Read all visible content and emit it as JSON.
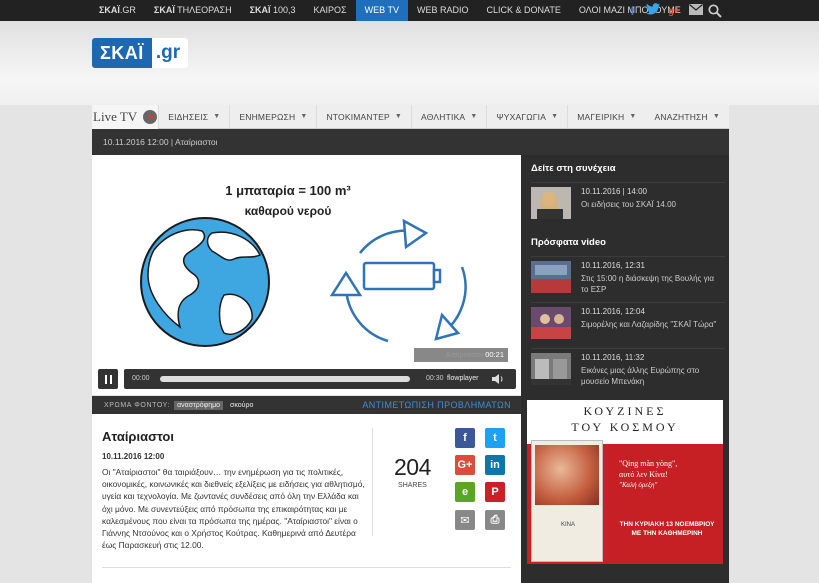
{
  "topnav": {
    "items": [
      {
        "bold": "ΣΚΑΪ",
        "rest": ".GR",
        "active": false
      },
      {
        "bold": "ΣΚΑΪ",
        "rest": " ΤΗΛΕΟΡΑΣΗ",
        "active": false
      },
      {
        "bold": "ΣΚΑΪ",
        "rest": " 100,3",
        "active": false
      },
      {
        "bold": "",
        "rest": "ΚΑΙΡΟΣ",
        "active": false
      },
      {
        "bold": "",
        "rest": "WEB TV",
        "active": true
      },
      {
        "bold": "",
        "rest": "WEB RADIO",
        "active": false
      },
      {
        "bold": "",
        "rest": "CLICK & DONATE",
        "active": false
      },
      {
        "bold": "",
        "rest": "ΟΛΟΙ ΜΑΖΙ ΜΠΟΡΟΥΜΕ",
        "active": false
      }
    ],
    "social_icons": [
      "facebook-icon",
      "twitter-icon",
      "googleplus-icon",
      "mail-icon"
    ]
  },
  "logo": {
    "main": "ΣΚΑΪ",
    "domain": ".gr"
  },
  "mainnav": {
    "live_tv": "Live TV",
    "items": [
      "ΕΙΔΗΣΕΙΣ",
      "ΕΝΗΜΕΡΩΣΗ",
      "ΝΤΟΚΙΜΑΝΤΕΡ",
      "ΑΘΛΗΤΙΚΑ",
      "ΨΥΧΑΓΩΓΙΑ",
      "ΜΑΓΕΙΡΙΚΗ"
    ],
    "search": "ΑΝΑΖΗΤΗΣΗ"
  },
  "breadcrumb": "10.11.2016 12:00 | Αταίριαστοι",
  "video": {
    "frame_text_line1": "1 μπαταρία = 100 m³",
    "frame_text_line2": "καθαρού νερού",
    "caption": "Αταίριαστοι",
    "caption_time": "00:21",
    "time_current": "00:00",
    "time_total": "00:30",
    "player_brand": "flowplayer"
  },
  "fontbar": {
    "label": "ΧΡΩΜΑ ΦΟΝΤΟΥ:",
    "options": [
      "αναστρόφημο",
      "σκούρο"
    ],
    "trouble": "ΑΝΤΙΜΕΤΩΠΙΣΗ ΠΡΟΒΛΗΜΑΤΩΝ"
  },
  "article": {
    "title": "Αταίριαστοι",
    "date": "10.11.2016 12:00",
    "body": "Οι \"Αταίριαστοι\" θα ταιριάξουν… την ενημέρωση για τις πολιτικές, οικονομικές, κοινωνικές και διεθνείς εξελίξεις με ειδήσεις για αθλητισμό, υγεία και τεχνολογία. Με ζωντανές συνδέσεις από όλη την Ελλάδα και όχι μόνο. Με συνεντεύξεις από πρόσωπα της επικαιρότητας και με καλεσμένους που είναι τα πρόσωπα της ημέρας. \"Αταίριαστοι\" είναι ο Γιάννης Ντσούνος και ο Χρήστος Κούτρας. Καθημερινά από Δευτέρα έως Παρασκευή στις 12.00.",
    "shares_count": "204",
    "shares_label": "SHARES",
    "share_buttons": [
      {
        "name": "facebook-share-icon",
        "glyph": "f",
        "color": "#3b5998"
      },
      {
        "name": "twitter-share-icon",
        "glyph": "t",
        "color": "#1da1f2"
      },
      {
        "name": "googleplus-share-icon",
        "glyph": "G+",
        "color": "#dd4b39"
      },
      {
        "name": "linkedin-share-icon",
        "glyph": "in",
        "color": "#0e76a8"
      },
      {
        "name": "evernote-share-icon",
        "glyph": "e",
        "color": "#5ba525"
      },
      {
        "name": "pinterest-share-icon",
        "glyph": "P",
        "color": "#cb2027"
      },
      {
        "name": "email-share-icon",
        "glyph": "✉",
        "color": "#888888"
      },
      {
        "name": "print-share-icon",
        "glyph": "⎙",
        "color": "#888888"
      }
    ]
  },
  "sidebar": {
    "next_heading": "Δείτε στη συνέχεια",
    "next_items": [
      {
        "date": "10.11.2016 | 14:00",
        "title": "Οι ειδήσεις του ΣΚΑΪ 14.00"
      }
    ],
    "recent_heading": "Πρόσφατα video",
    "recent_items": [
      {
        "date": "10.11.2016, 12:31",
        "title": "Στις 15:00 η διάσκεψη της Βουλής για το ΕΣΡ"
      },
      {
        "date": "10.11.2016, 12:04",
        "title": "Σιμορέλης και Λαζαρίδης \"ΣΚΑΪ Τώρα\""
      },
      {
        "date": "10.11.2016, 11:32",
        "title": "Εικόνες μιας άλλης Ευρώπης στο μουσείο Μπενάκη"
      }
    ]
  },
  "ad": {
    "heading1": "ΚΟΥΖΙΝΕΣ",
    "heading2": "ΤΟΥ ΚΟΣΜΟΥ",
    "book_title": "ΚΙΝΑ",
    "quote1": "\"Qing màn yòng\",",
    "quote2": "αυτό λεν Κίνα!",
    "quote3": "\"Καλή όρεξη\"",
    "promo1": "ΤΗΝ ΚΥΡΙΑΚΗ 13 ΝΟΕΜΒΡΙΟΥ",
    "promo2": "ΜΕ ΤΗΝ ΚΑΘΗΜΕΡΙΝΗ"
  }
}
